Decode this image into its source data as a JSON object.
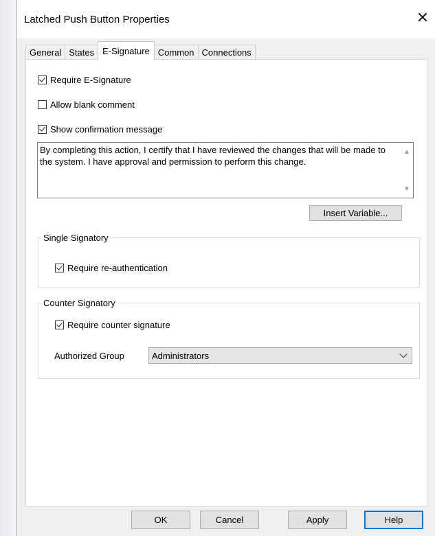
{
  "window": {
    "title": "Latched Push Button Properties",
    "close_glyph": "✕"
  },
  "tabs": [
    {
      "label": "General"
    },
    {
      "label": "States"
    },
    {
      "label": "E-Signature"
    },
    {
      "label": "Common"
    },
    {
      "label": "Connections"
    }
  ],
  "active_tab": "E-Signature",
  "esignature": {
    "require_esignature": {
      "label": "Require E-Signature",
      "checked": true
    },
    "allow_blank_comment": {
      "label": "Allow blank comment",
      "checked": false
    },
    "show_confirmation": {
      "label": "Show confirmation message",
      "checked": true
    },
    "message": "By completing this action, I certify that I have reviewed the changes that will be made to the system. I have approval and permission to perform this change.",
    "insert_variable_label": "Insert Variable..."
  },
  "single_signatory": {
    "legend": "Single Signatory",
    "require_reauth": {
      "label": "Require re-authentication",
      "checked": true
    }
  },
  "counter_signatory": {
    "legend": "Counter Signatory",
    "require_counter": {
      "label": "Require counter signature",
      "checked": true
    },
    "authorized_group_label": "Authorized Group",
    "authorized_group_value": "Administrators"
  },
  "footer": {
    "ok": "OK",
    "cancel": "Cancel",
    "apply": "Apply",
    "help": "Help"
  }
}
